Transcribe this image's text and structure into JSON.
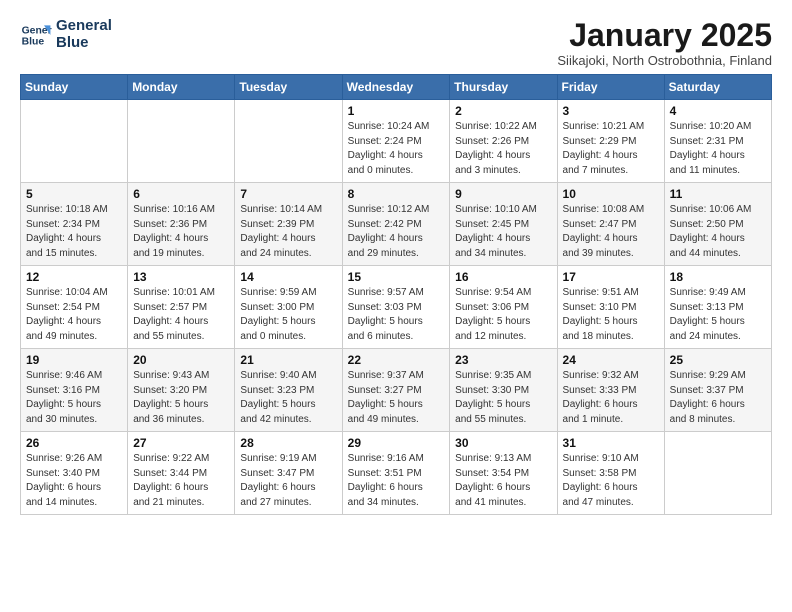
{
  "logo": {
    "line1": "General",
    "line2": "Blue"
  },
  "title": "January 2025",
  "location": "Siikajoki, North Ostrobothnia, Finland",
  "weekdays": [
    "Sunday",
    "Monday",
    "Tuesday",
    "Wednesday",
    "Thursday",
    "Friday",
    "Saturday"
  ],
  "weeks": [
    [
      {
        "day": "",
        "info": ""
      },
      {
        "day": "",
        "info": ""
      },
      {
        "day": "",
        "info": ""
      },
      {
        "day": "1",
        "info": "Sunrise: 10:24 AM\nSunset: 2:24 PM\nDaylight: 4 hours\nand 0 minutes."
      },
      {
        "day": "2",
        "info": "Sunrise: 10:22 AM\nSunset: 2:26 PM\nDaylight: 4 hours\nand 3 minutes."
      },
      {
        "day": "3",
        "info": "Sunrise: 10:21 AM\nSunset: 2:29 PM\nDaylight: 4 hours\nand 7 minutes."
      },
      {
        "day": "4",
        "info": "Sunrise: 10:20 AM\nSunset: 2:31 PM\nDaylight: 4 hours\nand 11 minutes."
      }
    ],
    [
      {
        "day": "5",
        "info": "Sunrise: 10:18 AM\nSunset: 2:34 PM\nDaylight: 4 hours\nand 15 minutes."
      },
      {
        "day": "6",
        "info": "Sunrise: 10:16 AM\nSunset: 2:36 PM\nDaylight: 4 hours\nand 19 minutes."
      },
      {
        "day": "7",
        "info": "Sunrise: 10:14 AM\nSunset: 2:39 PM\nDaylight: 4 hours\nand 24 minutes."
      },
      {
        "day": "8",
        "info": "Sunrise: 10:12 AM\nSunset: 2:42 PM\nDaylight: 4 hours\nand 29 minutes."
      },
      {
        "day": "9",
        "info": "Sunrise: 10:10 AM\nSunset: 2:45 PM\nDaylight: 4 hours\nand 34 minutes."
      },
      {
        "day": "10",
        "info": "Sunrise: 10:08 AM\nSunset: 2:47 PM\nDaylight: 4 hours\nand 39 minutes."
      },
      {
        "day": "11",
        "info": "Sunrise: 10:06 AM\nSunset: 2:50 PM\nDaylight: 4 hours\nand 44 minutes."
      }
    ],
    [
      {
        "day": "12",
        "info": "Sunrise: 10:04 AM\nSunset: 2:54 PM\nDaylight: 4 hours\nand 49 minutes."
      },
      {
        "day": "13",
        "info": "Sunrise: 10:01 AM\nSunset: 2:57 PM\nDaylight: 4 hours\nand 55 minutes."
      },
      {
        "day": "14",
        "info": "Sunrise: 9:59 AM\nSunset: 3:00 PM\nDaylight: 5 hours\nand 0 minutes."
      },
      {
        "day": "15",
        "info": "Sunrise: 9:57 AM\nSunset: 3:03 PM\nDaylight: 5 hours\nand 6 minutes."
      },
      {
        "day": "16",
        "info": "Sunrise: 9:54 AM\nSunset: 3:06 PM\nDaylight: 5 hours\nand 12 minutes."
      },
      {
        "day": "17",
        "info": "Sunrise: 9:51 AM\nSunset: 3:10 PM\nDaylight: 5 hours\nand 18 minutes."
      },
      {
        "day": "18",
        "info": "Sunrise: 9:49 AM\nSunset: 3:13 PM\nDaylight: 5 hours\nand 24 minutes."
      }
    ],
    [
      {
        "day": "19",
        "info": "Sunrise: 9:46 AM\nSunset: 3:16 PM\nDaylight: 5 hours\nand 30 minutes."
      },
      {
        "day": "20",
        "info": "Sunrise: 9:43 AM\nSunset: 3:20 PM\nDaylight: 5 hours\nand 36 minutes."
      },
      {
        "day": "21",
        "info": "Sunrise: 9:40 AM\nSunset: 3:23 PM\nDaylight: 5 hours\nand 42 minutes."
      },
      {
        "day": "22",
        "info": "Sunrise: 9:37 AM\nSunset: 3:27 PM\nDaylight: 5 hours\nand 49 minutes."
      },
      {
        "day": "23",
        "info": "Sunrise: 9:35 AM\nSunset: 3:30 PM\nDaylight: 5 hours\nand 55 minutes."
      },
      {
        "day": "24",
        "info": "Sunrise: 9:32 AM\nSunset: 3:33 PM\nDaylight: 6 hours\nand 1 minute."
      },
      {
        "day": "25",
        "info": "Sunrise: 9:29 AM\nSunset: 3:37 PM\nDaylight: 6 hours\nand 8 minutes."
      }
    ],
    [
      {
        "day": "26",
        "info": "Sunrise: 9:26 AM\nSunset: 3:40 PM\nDaylight: 6 hours\nand 14 minutes."
      },
      {
        "day": "27",
        "info": "Sunrise: 9:22 AM\nSunset: 3:44 PM\nDaylight: 6 hours\nand 21 minutes."
      },
      {
        "day": "28",
        "info": "Sunrise: 9:19 AM\nSunset: 3:47 PM\nDaylight: 6 hours\nand 27 minutes."
      },
      {
        "day": "29",
        "info": "Sunrise: 9:16 AM\nSunset: 3:51 PM\nDaylight: 6 hours\nand 34 minutes."
      },
      {
        "day": "30",
        "info": "Sunrise: 9:13 AM\nSunset: 3:54 PM\nDaylight: 6 hours\nand 41 minutes."
      },
      {
        "day": "31",
        "info": "Sunrise: 9:10 AM\nSunset: 3:58 PM\nDaylight: 6 hours\nand 47 minutes."
      },
      {
        "day": "",
        "info": ""
      }
    ]
  ]
}
